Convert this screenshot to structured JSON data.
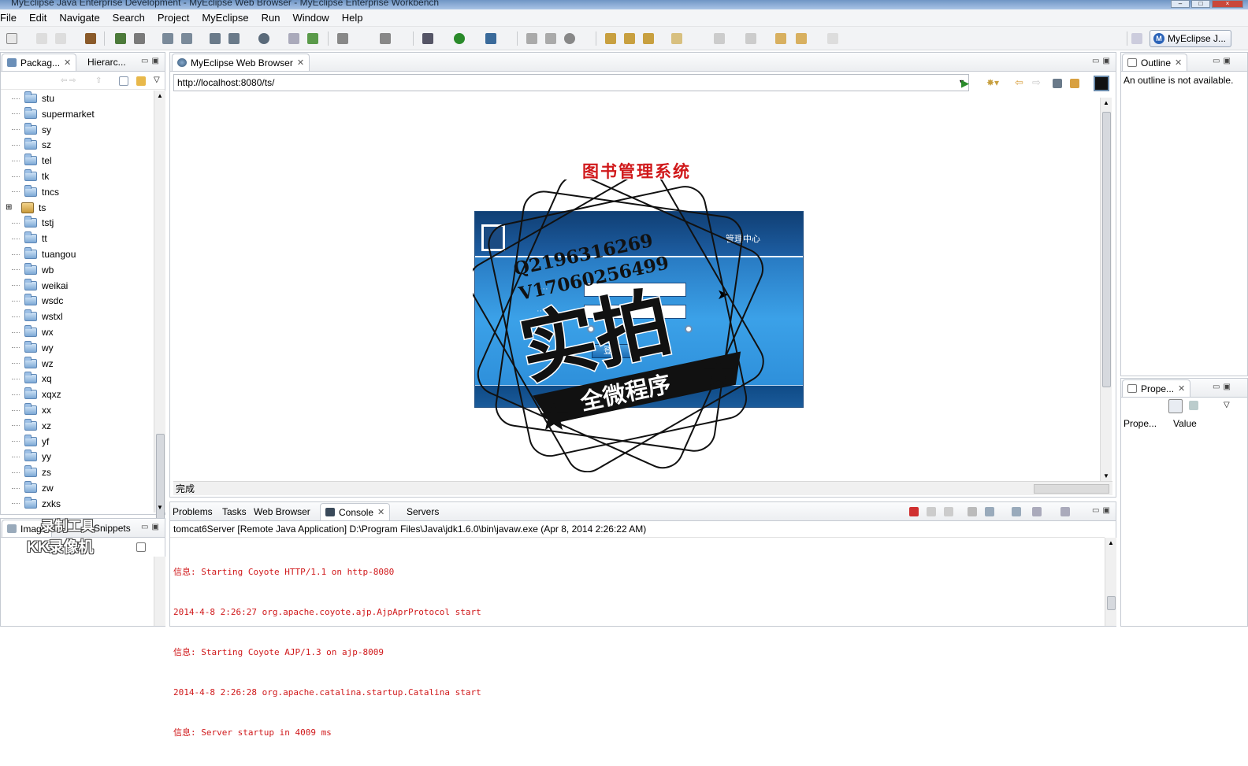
{
  "window": {
    "title": "MyEclipse Java Enterprise Development - MyEclipse Web Browser - MyEclipse Enterprise Workbench"
  },
  "menu": [
    "File",
    "Edit",
    "Navigate",
    "Search",
    "Project",
    "MyEclipse",
    "Run",
    "Window",
    "Help"
  ],
  "perspective": {
    "label": "MyEclipse J..."
  },
  "left_panel": {
    "tabs": [
      "Packag...",
      "Hierarc..."
    ],
    "tree": [
      {
        "label": "stu"
      },
      {
        "label": "supermarket"
      },
      {
        "label": "sy"
      },
      {
        "label": "sz"
      },
      {
        "label": "tel"
      },
      {
        "label": "tk"
      },
      {
        "label": "tncs"
      },
      {
        "label": "ts",
        "expandable": true
      },
      {
        "label": "tstj"
      },
      {
        "label": "tt"
      },
      {
        "label": "tuangou"
      },
      {
        "label": "wb"
      },
      {
        "label": "weikai"
      },
      {
        "label": "wsdc"
      },
      {
        "label": "wstxl"
      },
      {
        "label": "wx"
      },
      {
        "label": "wy"
      },
      {
        "label": "wz"
      },
      {
        "label": "xq"
      },
      {
        "label": "xqxz"
      },
      {
        "label": "xx"
      },
      {
        "label": "xz"
      },
      {
        "label": "yf"
      },
      {
        "label": "yy"
      },
      {
        "label": "zs"
      },
      {
        "label": "zw"
      },
      {
        "label": "zxks"
      }
    ]
  },
  "left_bottom": {
    "tabs": [
      "Image",
      "Snippets"
    ]
  },
  "browser": {
    "tab": "MyEclipse Web Browser",
    "url": "http://localhost:8080/ts/",
    "page": {
      "heading": "图书管理系统",
      "login": {
        "title": "管理中心",
        "button": "登陆"
      }
    },
    "status": "完成"
  },
  "outline": {
    "tab": "Outline",
    "message": "An outline is not available."
  },
  "properties": {
    "tab": "Prope...",
    "col_property": "Prope...",
    "col_value": "Value"
  },
  "bottom_panel": {
    "tabs": [
      "Problems",
      "Tasks",
      "Web Browser",
      "Console",
      "Servers"
    ],
    "active_tab": "Console",
    "console_header": "tomcat6Server [Remote Java Application] D:\\Program Files\\Java\\jdk1.6.0\\bin\\javaw.exe (Apr 8, 2014 2:26:22 AM)",
    "console_lines": [
      "信息: Starting Coyote HTTP/1.1 on http-8080",
      "2014-4-8 2:26:27 org.apache.coyote.ajp.AjpAprProtocol start",
      "信息: Starting Coyote AJP/1.3 on ajp-8009",
      "2014-4-8 2:26:28 org.apache.catalina.startup.Catalina start",
      "信息: Server startup in 4009 ms"
    ]
  },
  "overlay": {
    "stamp_line1": "Q2196316269",
    "stamp_line2": "V17060256499",
    "stamp_main": "实拍",
    "stamp_banner": "全微程序",
    "watermark_top": "录制工具",
    "watermark_bottom": "KK录像机"
  },
  "colors": {
    "heading_red": "#d0191b",
    "login_blue": "#2a8ad6",
    "console_red": "#d0191b"
  }
}
